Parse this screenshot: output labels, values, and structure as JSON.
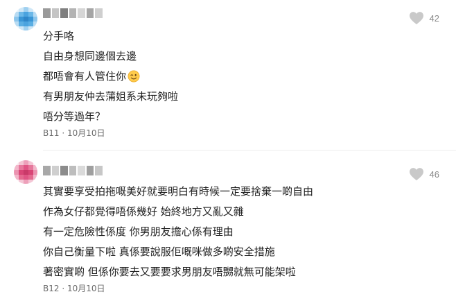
{
  "comments": [
    {
      "body_lines": [
        "分手咯",
        "自由身想同邊個去邊",
        "都唔會有人管住你",
        "有男朋友仲去蒲姐系未玩夠啦",
        "唔分等過年？"
      ],
      "emoji_after_line_3": "winking-face",
      "floor": "B11",
      "date": "10月10日",
      "separator": "·",
      "likes": "42"
    },
    {
      "body_lines": [
        "其實要享受拍拖嘅美好就要明白有時候一定要捨棄一啲自由",
        "作為女仔都覺得唔係幾好 始終地方又亂又雜",
        "有一定危險性係度 你男朋友擔心係有理由",
        "你自己衡量下啦 真係要說服佢嘅咪做多啲安全措施",
        "著密實啲 但係你要去又要要求男朋友唔嬲就無可能架啦"
      ],
      "floor": "B12",
      "date": "10月10日",
      "separator": "·",
      "likes": "46"
    }
  ],
  "colors": {
    "avatar1": "#4aa3df",
    "avatar2": "#e05585",
    "heart": "#c9c9c9",
    "meta_text": "#6b6b6b",
    "body_text": "#1f1f1f"
  },
  "icons": {
    "like": "heart-icon",
    "emoji": "winking-face-emoji"
  }
}
